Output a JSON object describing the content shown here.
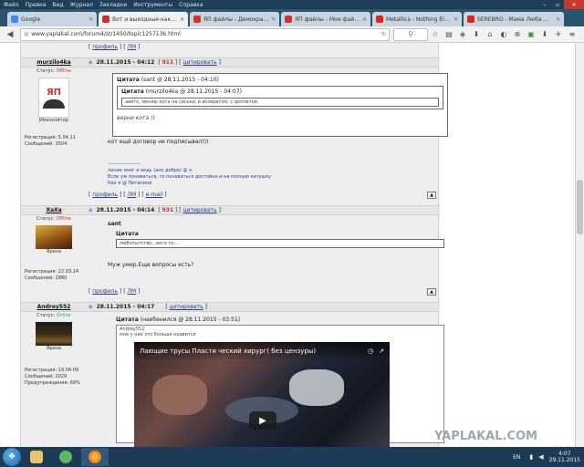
{
  "menubar": {
    "items": [
      "Файл",
      "Правка",
      "Вид",
      "Журнал",
      "Закладки",
      "Инструменты",
      "Справка"
    ]
  },
  "tabs": [
    {
      "label": "Google",
      "color": "#4285f4"
    },
    {
      "label": "Вот и выходные-какие ...",
      "color": "#d32f2f"
    },
    {
      "label": "ЯП файлы - Демократ1",
      "color": "#d32f2f"
    },
    {
      "label": "ЯП файлы - Мои файлы",
      "color": "#d32f2f"
    },
    {
      "label": "Metallica - Nothing Else ...",
      "color": "#e62117"
    },
    {
      "label": "SEREBRO - Мама Люба ...",
      "color": "#e62117"
    }
  ],
  "nav": {
    "url": "www.yaplakal.com/forum4/st/1450/topic1257136.html"
  },
  "posts": [
    {
      "links": [
        "профиль",
        "ЛМ"
      ],
      "user": {
        "name": "murzilo4ka",
        "status_label": "Статус: ",
        "status": "Offline",
        "rank": "Имхонэйтор",
        "reg": "Регистрация: 5.04.11",
        "msgs": "Сообщений: 3504"
      },
      "date": "28.11.2015 - 04:12",
      "num": "911",
      "cite": "цитировать",
      "quote_head_label": "Цитата",
      "quote_head_rest": " (sant @ 28.11.2015 - 04:10)",
      "inner_head_label": "Цитата",
      "inner_head_rest": " (murzilo4ka @ 28.11.2015 - 04:07)",
      "inner_text": "авито, меняю кота на сиськи, в возврат​ом, с доплатой.",
      "quote_text": "верни кота ))",
      "text": "кот ещё договор не подписывал)))",
      "sig_line": "--------------------",
      "sig": [
        "лоние иног и ведь (ано добро) @ я",
        "Если уж поноваться, то поноваться достойно и на полную катушку",
        "Как я @ Питапини"
      ]
    },
    {
      "links": [
        "профиль",
        "ЛМ",
        "e-mail"
      ],
      "user": {
        "name": "XaXa",
        "status_label": "Статус: ",
        "status": "Offline",
        "rank": "Ярила",
        "reg": "Регистрация: 22.03.14",
        "msgs": "Сообщений: 2880"
      },
      "date": "28.11.2015 - 04:14",
      "num": "931",
      "cite": "цитировать",
      "addressee": "sant",
      "quote_head_label": "Цитата",
      "inner_text": "любопытство...вого то...",
      "text": "Муж умер.Еще вопросы есть?"
    },
    {
      "links": [
        "профиль",
        "ЛМ"
      ],
      "user": {
        "name": "Andrey552",
        "status_label": "Статус: ",
        "status": "Online",
        "rank": "Ярила",
        "reg": "Регистрация: 19.04.09",
        "msgs": "Сообщений: 2029",
        "warn": "Предупреждения: 60%"
      },
      "date": "28.11.2015 - 04:17",
      "cite": "цитировать",
      "quote_head_label": "Цитата",
      "quote_head_rest": " (наебенился @ 28.11.2015 - 03:51)",
      "quote_author": "Andrey552",
      "quote_sub": "мне у них это больше нравится",
      "video_title": "Лающие трусы Пласти ческий хирург( без цензуры)"
    }
  ],
  "strip3_links": [
    "профиль",
    "ЛМ"
  ],
  "watermark": "YAPLAKAL.COM",
  "taskbar": {
    "lang": "EN",
    "time": "4:07",
    "date": "29.11.2015"
  }
}
